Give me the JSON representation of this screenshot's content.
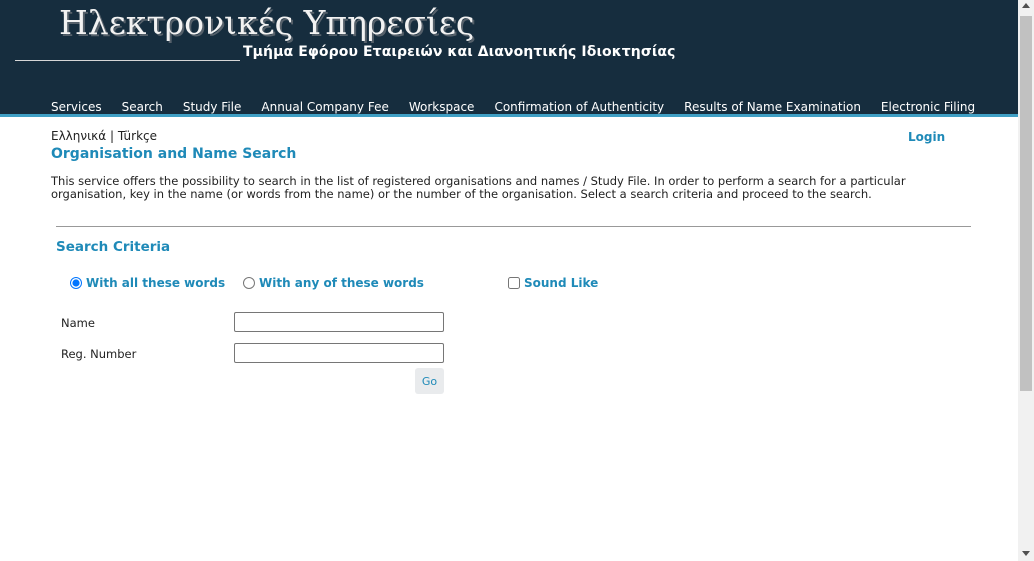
{
  "header": {
    "title": "Ηλεκτρονικές Υπηρεσίες",
    "subtitle": "Τμήμα Εφόρου Εταιρειών και Διανοητικής Ιδιοκτησίας",
    "nav": [
      "Services",
      "Search",
      "Study File",
      "Annual Company Fee",
      "Workspace",
      "Confirmation of Authenticity",
      "Results of Name Examination",
      "Electronic Filing"
    ]
  },
  "lang": {
    "greek": "Ελληνικά",
    "separator": "|",
    "turkish": "Türkçe"
  },
  "login_label": "Login",
  "page_title": "Organisation and Name Search",
  "description": "This service offers the possibility to search in the list of registered organisations and names / Study File. In order to perform a search for a particular organisation, key in the name (or words from the name) or the number of the organisation. Select a search criteria and proceed to the search.",
  "search": {
    "section_title": "Search Criteria",
    "option_all": "With all these words",
    "option_any": "With any of these words",
    "option_sound": "Sound Like",
    "selected_option": "With all these words",
    "sound_like_checked": false,
    "name_label": "Name",
    "name_value": "",
    "reg_label": "Reg. Number",
    "reg_value": "",
    "go_label": "Go"
  },
  "colors": {
    "header_bg": "#162d3e",
    "accent": "#1f8ab8",
    "header_stripe": "#3f9fc4"
  }
}
